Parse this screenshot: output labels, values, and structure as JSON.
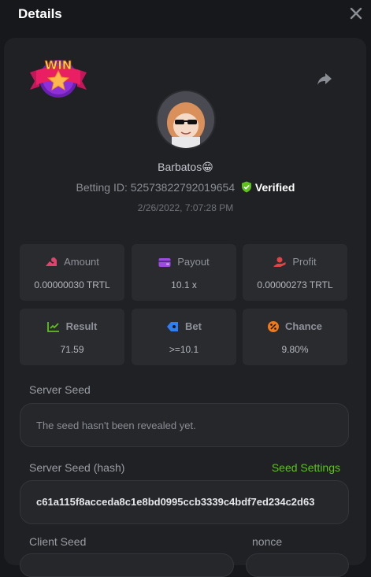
{
  "modal": {
    "title": "Details"
  },
  "badge": {
    "text": "WIN"
  },
  "user": {
    "name": "Barbatos",
    "emoji": "😁",
    "bet_id_label": "Betting ID:",
    "bet_id": "52573822792019654",
    "verified_label": "Verified",
    "date": "2/26/2022, 7:07:28 PM"
  },
  "stats": [
    {
      "label": "Amount",
      "value": "0.00000030 TRTL",
      "icon": "coins-icon",
      "color": "#e0446c"
    },
    {
      "label": "Payout",
      "value": "10.1 x",
      "icon": "wallet-icon",
      "color": "#9b4be0"
    },
    {
      "label": "Profit",
      "value": "0.00000273 TRTL",
      "icon": "hand-coin-icon",
      "color": "#e04444"
    },
    {
      "label": "Result",
      "value": "71.59",
      "icon": "chart-check-icon",
      "color": "#5dc21e"
    },
    {
      "label": "Bet",
      "value": ">=10.1",
      "icon": "tag-icon",
      "color": "#2f7ff0"
    },
    {
      "label": "Chance",
      "value": "9.80%",
      "icon": "percent-icon",
      "color": "#f07a1a"
    }
  ],
  "server_seed": {
    "label": "Server Seed",
    "text": "The seed hasn't been revealed yet."
  },
  "server_seed_hash": {
    "label": "Server Seed (hash)",
    "settings_label": "Seed Settings",
    "value": "c61a115f8acceda8c1e8bd0995ccb3339c4bdf7ed234c2d63"
  },
  "client_seed": {
    "label": "Client Seed"
  },
  "nonce": {
    "label": "nonce"
  },
  "colors": {
    "accent_green": "#5dc21e",
    "verified_shield": "#5dc21e"
  }
}
